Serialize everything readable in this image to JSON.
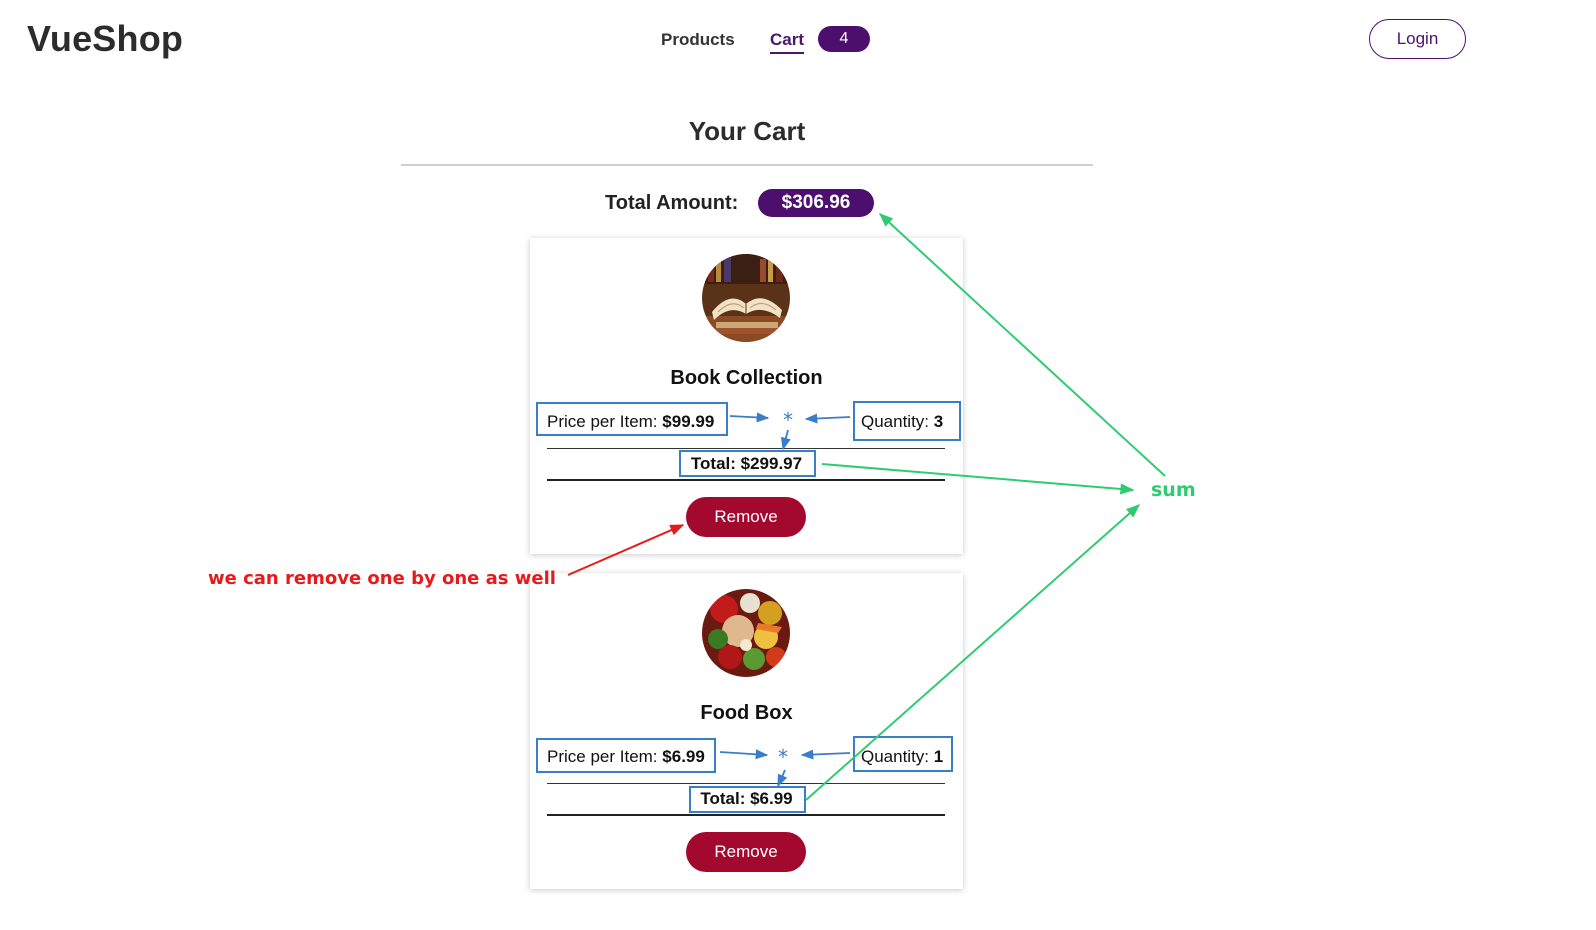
{
  "header": {
    "logo": "VueShop",
    "nav": {
      "products": "Products",
      "cart": "Cart",
      "cart_count": "4"
    },
    "login": "Login"
  },
  "cart": {
    "title": "Your Cart",
    "total_label": "Total Amount:",
    "total_value": "$306.96",
    "items": [
      {
        "name": "Book Collection",
        "price_label": "Price per Item:",
        "price": "$99.99",
        "qty_label": "Quantity:",
        "qty": "3",
        "total": "Total: $299.97",
        "remove": "Remove",
        "image_icon": "books-photo"
      },
      {
        "name": "Food Box",
        "price_label": "Price per Item:",
        "price": "$6.99",
        "qty_label": "Quantity:",
        "qty": "1",
        "total": "Total: $6.99",
        "remove": "Remove",
        "image_icon": "food-photo"
      }
    ]
  },
  "annotations": {
    "remove_note": "we can remove one by one as well",
    "sum_note": "sum",
    "multiply": "*",
    "colors": {
      "blue": "#3a7dc9",
      "green": "#2ecc71",
      "red": "#e51a1a"
    }
  },
  "theme": {
    "brand": "#4c0f6e",
    "danger": "#a3082f"
  }
}
